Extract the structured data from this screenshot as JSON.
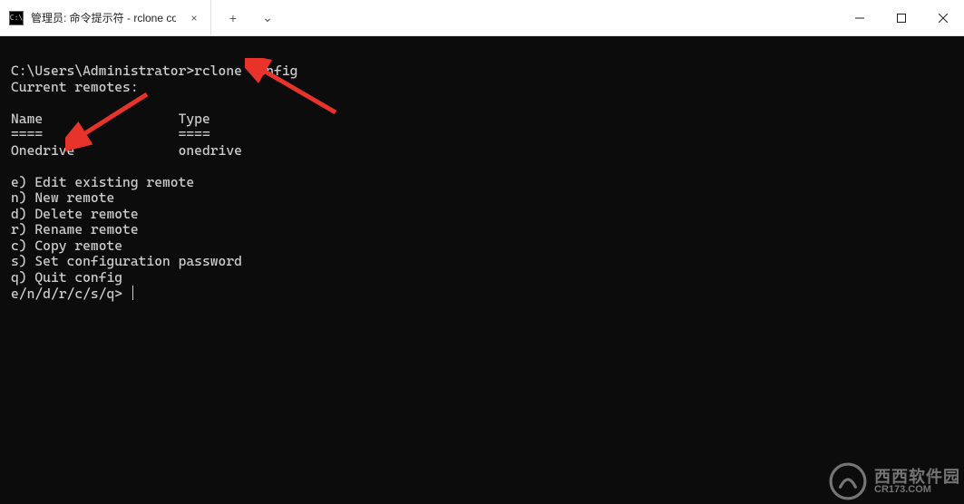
{
  "titlebar": {
    "tab_title": "管理员: 命令提示符 - rclone con",
    "tab_icon_label": "cmd-icon",
    "tab_close_label": "×",
    "new_tab_label": "+",
    "dropdown_label": "⌄",
    "minimize_label": "—",
    "maximize_label": "□",
    "close_label": "×"
  },
  "terminal": {
    "prompt_prefix": "C:\\Users\\Administrator>",
    "command": "rclone config",
    "current_remotes_label": "Current remotes:",
    "header_name": "Name",
    "header_type": "Type",
    "header_name_underline": "====",
    "header_type_underline": "====",
    "remotes": [
      {
        "name": "Onedrive",
        "type": "onedrive"
      }
    ],
    "menu": [
      {
        "key": "e",
        "label": "Edit existing remote"
      },
      {
        "key": "n",
        "label": "New remote"
      },
      {
        "key": "d",
        "label": "Delete remote"
      },
      {
        "key": "r",
        "label": "Rename remote"
      },
      {
        "key": "c",
        "label": "Copy remote"
      },
      {
        "key": "s",
        "label": "Set configuration password"
      },
      {
        "key": "q",
        "label": "Quit config"
      }
    ],
    "input_prompt": "e/n/d/r/c/s/q>"
  },
  "watermark": {
    "text_cn": "西西软件园",
    "text_url": "CR173.COM"
  },
  "annotations": {
    "arrow1_target": "rclone config command",
    "arrow2_target": "Onedrive remote"
  }
}
